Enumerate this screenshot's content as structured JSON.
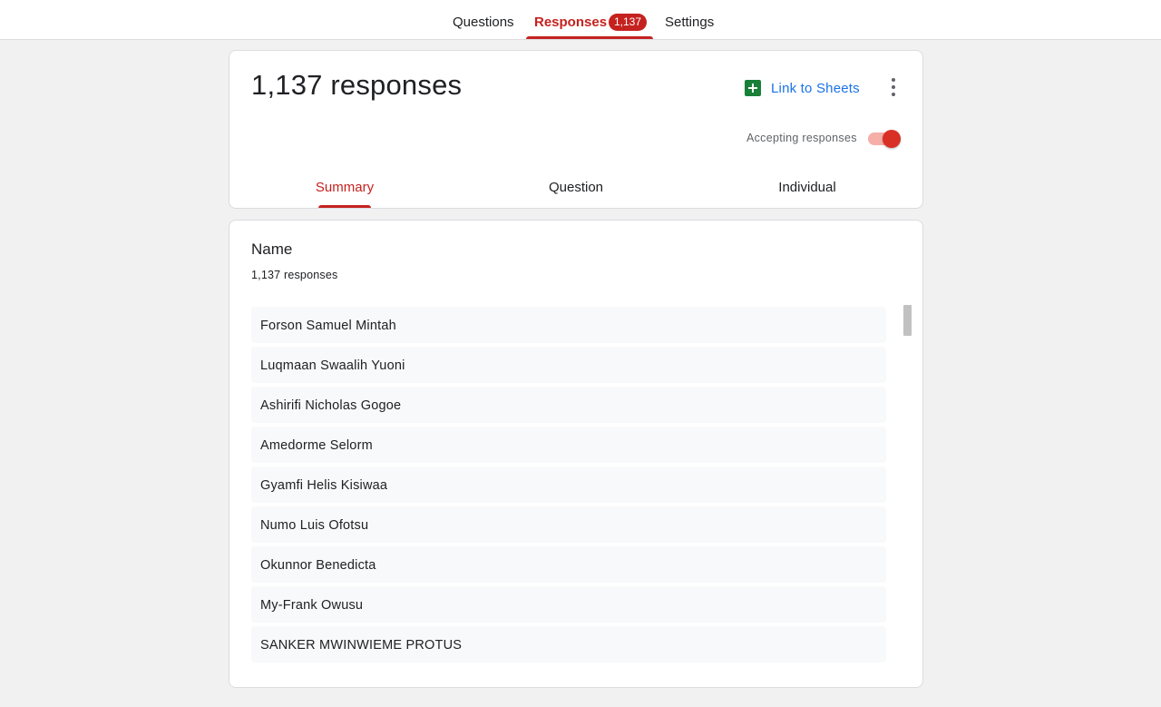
{
  "nav": {
    "questions_label": "Questions",
    "responses_label": "Responses",
    "responses_badge": "1,137",
    "settings_label": "Settings"
  },
  "header": {
    "title": "1,137 responses",
    "sheets_link_label": "Link to Sheets",
    "accepting_label": "Accepting responses",
    "accepting_enabled": true,
    "tabs": [
      {
        "label": "Summary",
        "active": true
      },
      {
        "label": "Question",
        "active": false
      },
      {
        "label": "Individual",
        "active": false
      }
    ]
  },
  "question": {
    "title": "Name",
    "response_count": "1,137 responses",
    "answers": [
      "Forson Samuel Mintah",
      "Luqmaan Swaalih Yuoni",
      "Ashirifi Nicholas Gogoe",
      "Amedorme Selorm",
      "Gyamfi Helis Kisiwaa",
      "Numo Luis Ofotsu",
      "Okunnor Benedicta",
      "My-Frank Owusu",
      "SANKER MWINWIEME PROTUS"
    ]
  },
  "colors": {
    "accent": "#c5221f",
    "link": "#1a73e8",
    "sheets_green": "#188038",
    "background": "#f1f1f1"
  },
  "icons": {
    "sheets": "sheets-icon",
    "more": "more-vert-icon"
  }
}
